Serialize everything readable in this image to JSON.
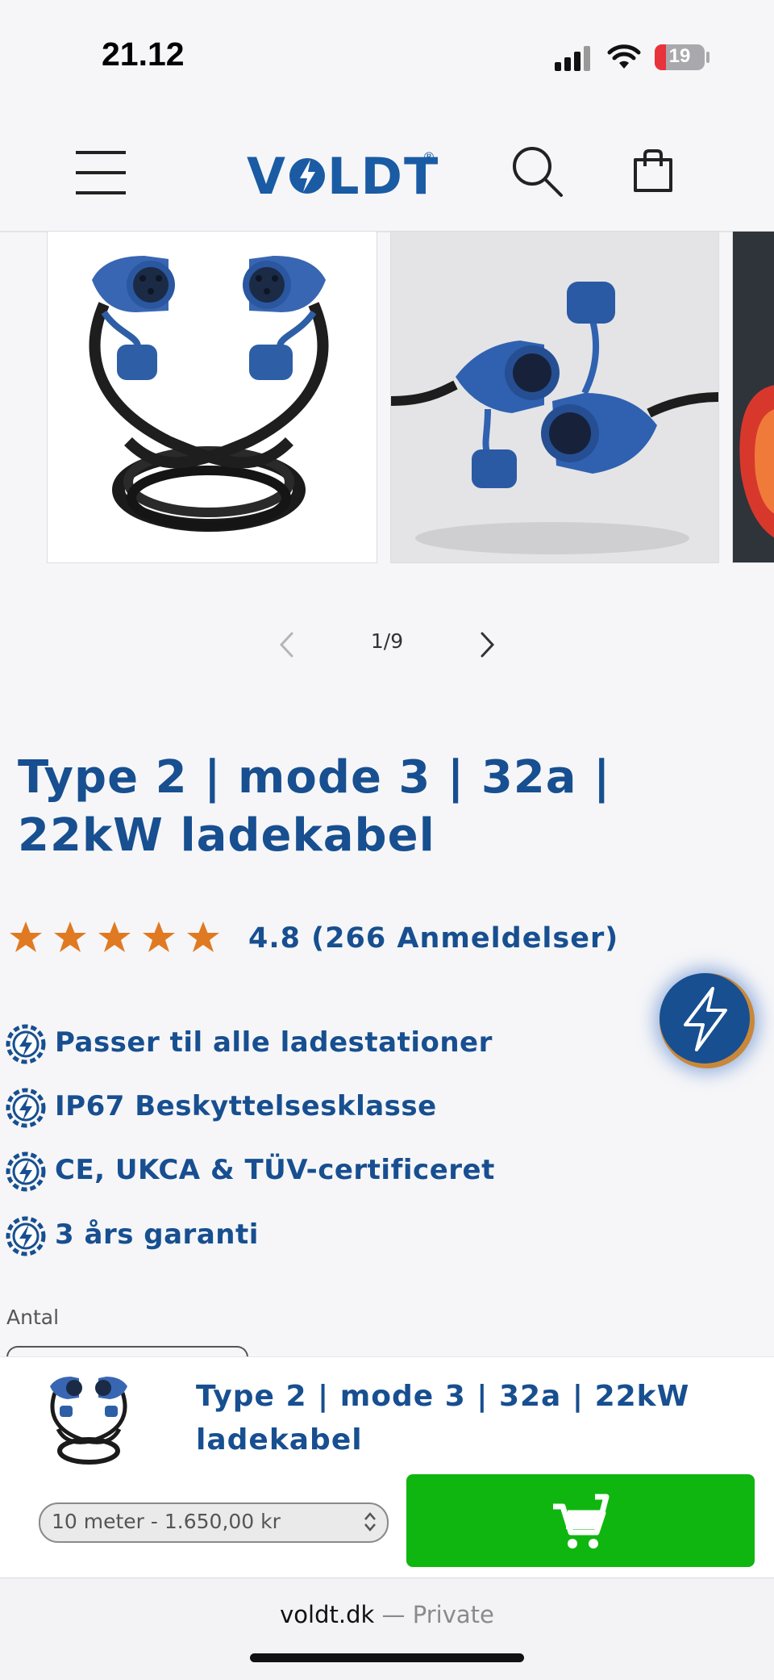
{
  "status_bar": {
    "time": "21.12",
    "battery": "19"
  },
  "header": {
    "logo": "VOLDT",
    "logo_reg": "®"
  },
  "gallery": {
    "pager": "1/9"
  },
  "product": {
    "title": "Type 2 | mode 3 | 32a | 22kW ladekabel",
    "rating": 4.8,
    "rating_text": "4.8 (266 Anmeldelser)",
    "features": [
      "Passer til alle ladestationer",
      "IP67 Beskyttelsesklasse",
      "CE, UKCA & TÜV-certificeret",
      "3 års garanti"
    ],
    "quantity_label": "Antal"
  },
  "sticky_bar": {
    "title": "Type 2 | mode 3 | 32a | 22kW ladekabel",
    "variant": "10 meter - 1.650,00 kr"
  },
  "browser": {
    "domain": "voldt.dk",
    "separator": " — ",
    "mode": "Private"
  },
  "colors": {
    "brand_blue": "#174f90",
    "star_orange": "#e07a22",
    "cart_green": "#0fb60f"
  }
}
